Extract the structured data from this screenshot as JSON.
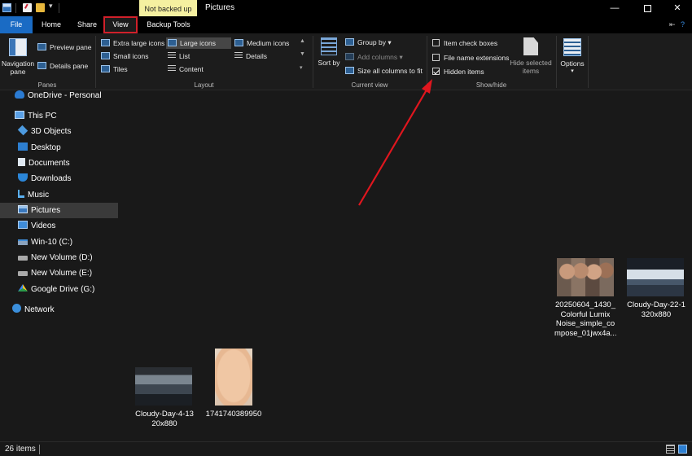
{
  "window": {
    "title": "Pictures",
    "tool_tab_header": "Not backed up"
  },
  "tabs": {
    "file": "File",
    "home": "Home",
    "share": "Share",
    "view": "View",
    "backup": "Backup Tools"
  },
  "ribbon": {
    "panes": {
      "label": "Panes",
      "navigation_pane": "Navigation pane",
      "preview_pane": "Preview pane",
      "details_pane": "Details pane"
    },
    "layout": {
      "label": "Layout",
      "items": [
        "Extra large icons",
        "Large icons",
        "Medium icons",
        "Small icons",
        "List",
        "Details",
        "Tiles",
        "Content"
      ],
      "selected": "Large icons"
    },
    "current_view": {
      "label": "Current view",
      "sort_by": "Sort by",
      "group_by": "Group by",
      "add_columns": "Add columns",
      "size_all_columns": "Size all columns to fit"
    },
    "show_hide": {
      "label": "Show/hide",
      "item_check_boxes": "Item check boxes",
      "file_name_extensions": "File name extensions",
      "hidden_items": "Hidden items",
      "hidden_items_checked": true,
      "hide_selected_items": "Hide selected items"
    },
    "options": "Options"
  },
  "sidebar": {
    "items": [
      {
        "label": "OneDrive - Personal",
        "icon": "cloud-icon"
      },
      {
        "label": "This PC",
        "icon": "pc-icon"
      },
      {
        "label": "3D Objects",
        "icon": "cube-icon"
      },
      {
        "label": "Desktop",
        "icon": "desktop-icon"
      },
      {
        "label": "Documents",
        "icon": "document-icon"
      },
      {
        "label": "Downloads",
        "icon": "download-icon"
      },
      {
        "label": "Music",
        "icon": "music-icon"
      },
      {
        "label": "Pictures",
        "icon": "pictures-icon",
        "selected": true
      },
      {
        "label": "Videos",
        "icon": "video-icon"
      },
      {
        "label": "Win-10 (C:)",
        "icon": "drive-icon"
      },
      {
        "label": "New Volume (D:)",
        "icon": "drive-icon"
      },
      {
        "label": "New Volume (E:)",
        "icon": "drive-icon"
      },
      {
        "label": "Google Drive (G:)",
        "icon": "google-drive-icon"
      },
      {
        "label": "Network",
        "icon": "network-icon"
      }
    ]
  },
  "files": [
    {
      "name": "20250604_1430_Colorful Lumix Noise_simple_compose_01jwx4a...",
      "lines": [
        "20250604_1430_",
        "Colorful Lumix",
        "Noise_simple_co",
        "mpose_01jwx4a..."
      ]
    },
    {
      "name": "Cloudy-Day-22-1320x880",
      "lines": [
        "Cloudy-Day-22-1",
        "320x880"
      ]
    },
    {
      "name": "Cloudy-Day-4-1320x880",
      "lines": [
        "Cloudy-Day-4-13",
        "20x880"
      ]
    },
    {
      "name": "1741740389950",
      "lines": [
        "1741740389950"
      ]
    }
  ],
  "status": {
    "item_count": "26 items"
  },
  "colors": {
    "accent": "#1a6bc4",
    "highlight_box": "#d0202a",
    "arrow": "#e0161e",
    "background": "#191919"
  }
}
